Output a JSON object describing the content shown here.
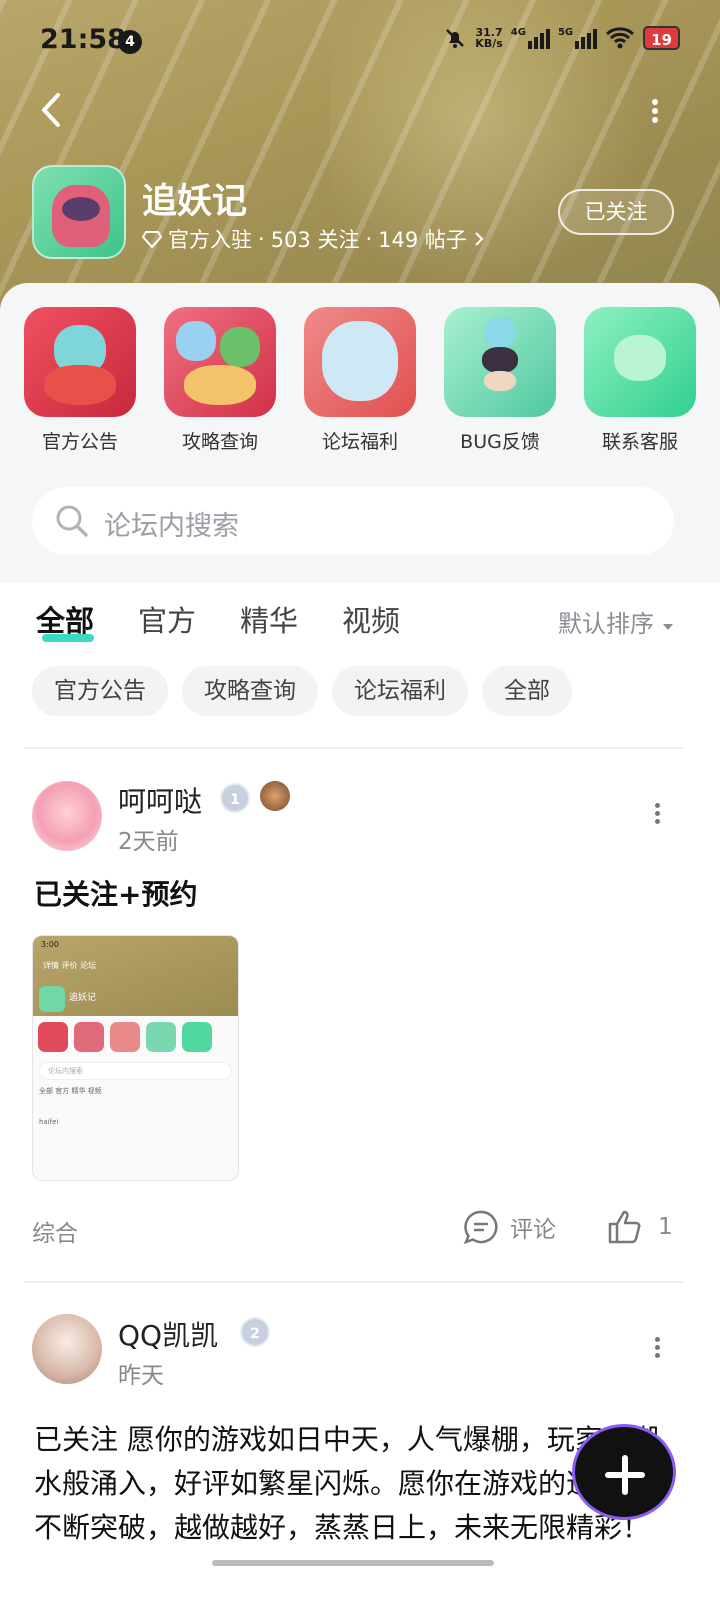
{
  "status": {
    "time": "21:58",
    "notif_count": "4",
    "speed_value": "31.7",
    "speed_unit": "KB/s",
    "net1": "4G",
    "net2": "5G",
    "battery": "19"
  },
  "forum": {
    "name": "追妖记",
    "meta_verified": "官方入驻",
    "meta_follows": "503 关注",
    "meta_posts": "149 帖子",
    "follow_label": "已关注"
  },
  "quick_links": [
    {
      "label": "官方公告"
    },
    {
      "label": "攻略查询"
    },
    {
      "label": "论坛福利"
    },
    {
      "label": "BUG反馈"
    },
    {
      "label": "联系客服"
    }
  ],
  "search": {
    "placeholder": "论坛内搜索"
  },
  "tabs": [
    {
      "label": "全部"
    },
    {
      "label": "官方"
    },
    {
      "label": "精华"
    },
    {
      "label": "视频"
    }
  ],
  "sort_label": "默认排序",
  "chips": [
    {
      "label": "官方公告"
    },
    {
      "label": "攻略查询"
    },
    {
      "label": "论坛福利"
    },
    {
      "label": "全部"
    }
  ],
  "posts": [
    {
      "author": "呵呵哒",
      "level": "1",
      "time": "2天前",
      "content": "已关注+预约",
      "category": "综合",
      "comment_label": "评论",
      "like_count": "1",
      "thumb": {
        "time": "3:00",
        "tabs": "详情  评价  论坛",
        "title": "追妖记",
        "search": "论坛内搜索",
        "tab_row": "全部  官方  精华  视频",
        "author": "haifei"
      }
    },
    {
      "author": "QQ凯凯",
      "level": "2",
      "time": "昨天",
      "content": "已关注 愿你的游戏如日中天，人气爆棚，玩家似潮水般涌入，好评如繁星闪烁。愿你在游戏的道路上不断突破，越做越好，蒸蒸日上，未来无限精彩！"
    }
  ],
  "colors": {
    "accent": "#3dd8c2",
    "header_bg": "#a99758",
    "panel_bg": "#f5f6f8"
  }
}
